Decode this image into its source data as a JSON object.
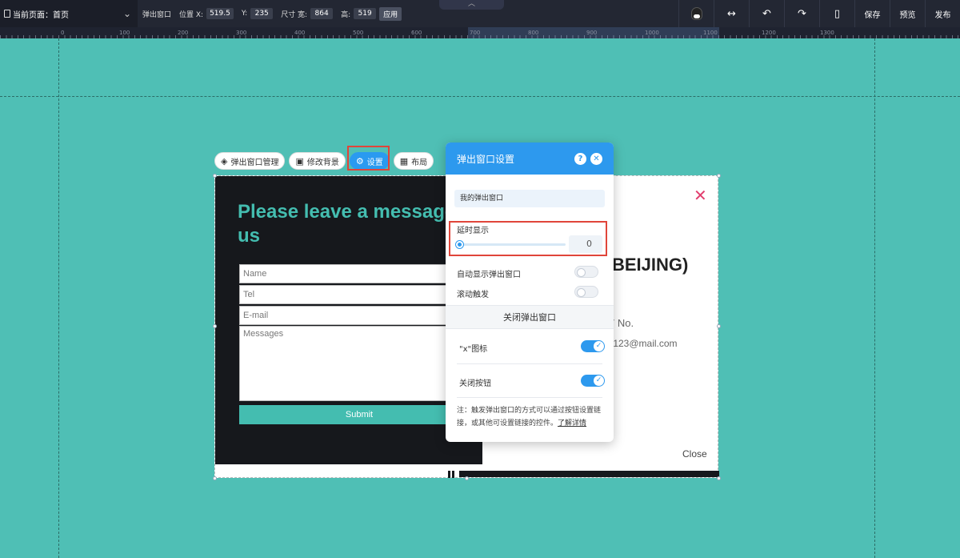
{
  "topbar": {
    "current_page_label": "当前页面：首页",
    "element_type": "弹出窗口",
    "pos_label": "位置 X:",
    "x_value": "519.5",
    "y_label": "Y:",
    "y_value": "235",
    "size_label": "尺寸 宽:",
    "width_value": "864",
    "height_label": "高:",
    "height_value": "519",
    "apply_label": "应用",
    "save_label": "保存",
    "preview_label": "预览",
    "publish_label": "发布"
  },
  "ruler": {
    "ticks": [
      "0",
      "100",
      "200",
      "300",
      "400",
      "500",
      "600",
      "700",
      "800",
      "900",
      "1000",
      "1100",
      "1200",
      "1300"
    ]
  },
  "popup_toolbar": {
    "manage_label": "弹出窗口管理",
    "background_label": "修改背景",
    "settings_label": "设置",
    "layout_label": "布局"
  },
  "popup": {
    "heading": "Please leave a message to us",
    "name_placeholder": "Name",
    "tel_placeholder": "Tel",
    "email_placeholder": "E-mail",
    "messages_placeholder": "Messages",
    "submit_label": "Submit",
    "brand_text": "BEIJING)",
    "address_text": "7 No.",
    "email_text": ":123@mail.com",
    "close_label": "Close"
  },
  "settings_panel": {
    "title": "弹出窗口设置",
    "help_glyph": "?",
    "close_glyph": "✕",
    "popup_name": "我的弹出窗口",
    "delay_label": "延时显示",
    "delay_value": 0,
    "auto_show_label": "自动显示弹出窗口",
    "scroll_trigger_label": "滚动触发",
    "close_section_label": "关闭弹出窗口",
    "x_icon_label": "\"x\"图标",
    "close_button_label": "关闭按钮",
    "note_text": "注：触发弹出窗口的方式可以通过按钮设置链接，或其他可设置链接的控件。",
    "note_link": "了解详情"
  },
  "colors": {
    "canvas_bg": "#4fbfb5",
    "accent": "#2d99ee",
    "popup_dark": "#16181c",
    "teal": "#44bdb0",
    "highlight": "#e0453a"
  }
}
